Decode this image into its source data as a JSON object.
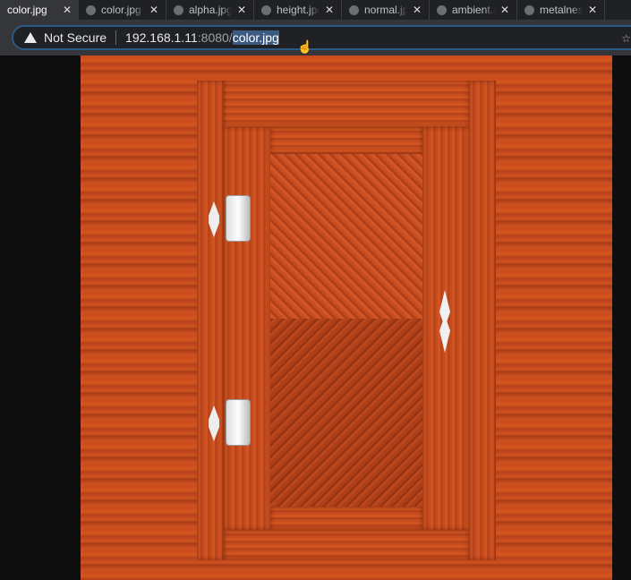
{
  "tabs": [
    {
      "label": "color.jpg",
      "active": true
    },
    {
      "label": "color.jpg"
    },
    {
      "label": "alpha.jpg"
    },
    {
      "label": "height.jpg"
    },
    {
      "label": "normal.jpg"
    },
    {
      "label": "ambient.jpg"
    },
    {
      "label": "metalness.jpg"
    }
  ],
  "address": {
    "security": "Not Secure",
    "host": "192.168.1.11",
    "port": ":8080/",
    "path": "color.jpg"
  },
  "image": {
    "alt": "wooden door texture"
  }
}
